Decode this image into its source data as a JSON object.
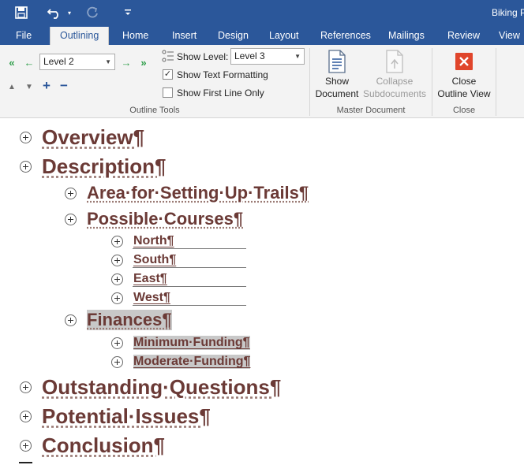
{
  "title_bar": {
    "document_title": "Biking P",
    "qat": {
      "save_icon": "save-icon",
      "undo_icon": "undo-icon",
      "redo_icon": "redo-icon",
      "customize_icon": "customize-qat-icon"
    }
  },
  "tabs": [
    {
      "label": "File"
    },
    {
      "label": "Outlining",
      "active": true
    },
    {
      "label": "Home"
    },
    {
      "label": "Insert"
    },
    {
      "label": "Design"
    },
    {
      "label": "Layout"
    },
    {
      "label": "References"
    },
    {
      "label": "Mailings"
    },
    {
      "label": "Review"
    },
    {
      "label": "View"
    }
  ],
  "ribbon": {
    "outline_tools": {
      "group_label": "Outline Tools",
      "outline_level_value": "Level 2",
      "show_level_label": "Show Level:",
      "show_level_value": "Level 3",
      "show_text_formatting_label": "Show Text Formatting",
      "show_text_formatting_checked": true,
      "show_first_line_only_label": "Show First Line Only",
      "show_first_line_only_checked": false
    },
    "master_document": {
      "group_label": "Master Document",
      "show_document_line1": "Show",
      "show_document_line2": "Document",
      "collapse_subdocuments_line1": "Collapse",
      "collapse_subdocuments_line2": "Subdocuments"
    },
    "close": {
      "group_label": "Close",
      "close_outline_view_line1": "Close",
      "close_outline_view_line2": "Outline View"
    }
  },
  "outline": {
    "items": [
      {
        "text": "Overview¶",
        "level": 1
      },
      {
        "text": "Description¶",
        "level": 1
      },
      {
        "text": "Area·for·Setting·Up·Trails¶",
        "level": 2
      },
      {
        "text": "Possible·Courses¶",
        "level": 2
      },
      {
        "text": "North¶",
        "level": 3
      },
      {
        "text": "South¶",
        "level": 3
      },
      {
        "text": "East¶",
        "level": 3
      },
      {
        "text": "West¶",
        "level": 3
      },
      {
        "text": "Finances¶",
        "level": 2,
        "selected": true
      },
      {
        "text": "Minimum·Funding¶",
        "level": 3,
        "selected": true
      },
      {
        "text": "Moderate·Funding¶",
        "level": 3,
        "selected": true
      },
      {
        "text": "Outstanding·Questions¶",
        "level": 1
      },
      {
        "text": "Potential·Issues¶",
        "level": 1
      },
      {
        "text": "Conclusion¶",
        "level": 1
      }
    ]
  }
}
